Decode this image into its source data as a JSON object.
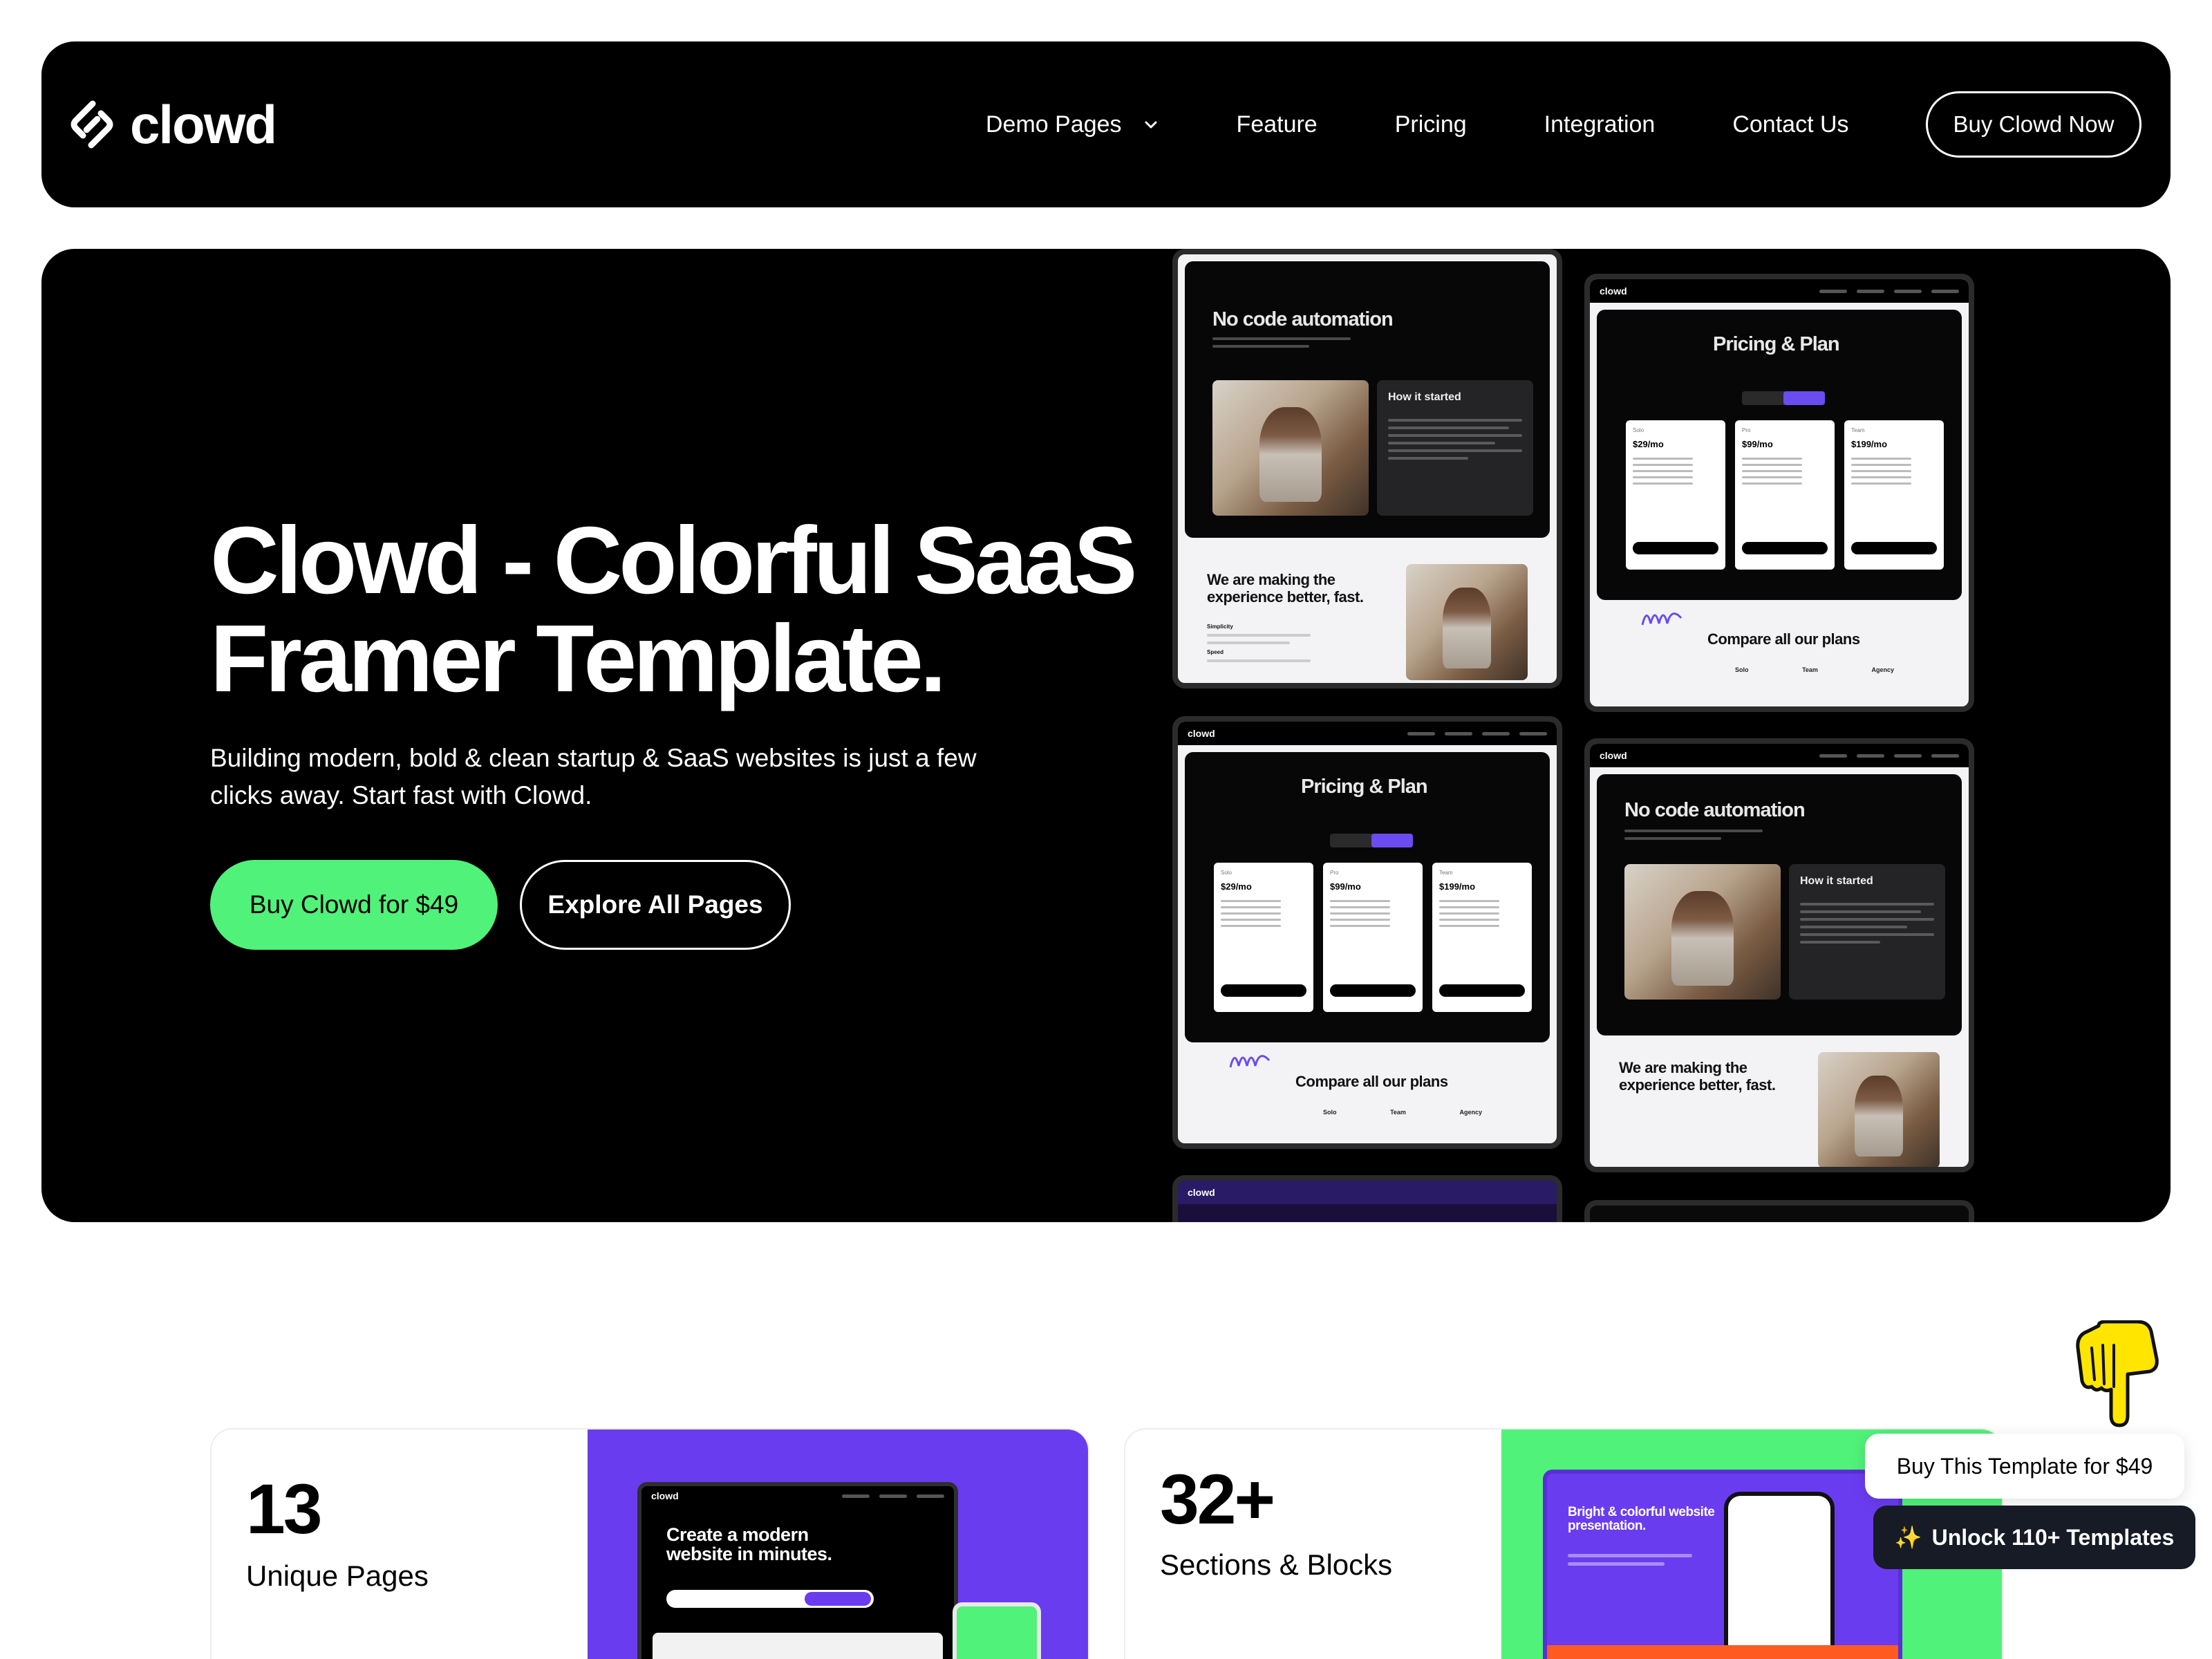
{
  "nav": {
    "logo_text": "clowd",
    "links": [
      {
        "label": "Demo Pages",
        "has_dropdown": true
      },
      {
        "label": "Feature"
      },
      {
        "label": "Pricing"
      },
      {
        "label": "Integration"
      },
      {
        "label": "Contact Us"
      }
    ],
    "cta_label": "Buy Clowd Now"
  },
  "hero": {
    "title": "Clowd - Colorful SaaS Framer Template.",
    "subtitle": "Building modern, bold & clean startup & SaaS websites is just a few clicks away. Start fast with Clowd.",
    "primary_button": "Buy Clowd for $49",
    "secondary_button": "Explore All Pages",
    "previews": {
      "logo": "clowd",
      "automation_title": "No code automation",
      "story_title": "How it started",
      "making_title": "We are making the experience better, fast.",
      "making_items": [
        "Simplicity",
        "Speed"
      ],
      "pricing_title": "Pricing & Plan",
      "compare_title": "Compare all our plans",
      "plans": [
        {
          "name": "Solo",
          "price": "$29/mo"
        },
        {
          "name": "Pro",
          "price": "$99/mo"
        },
        {
          "name": "Team",
          "price": "$199/mo"
        }
      ],
      "table_cols": [
        "Solo",
        "Team",
        "Agency"
      ]
    }
  },
  "stats": [
    {
      "number": "13",
      "label": "Unique Pages",
      "media_color": "#6a3cf0",
      "mock_title": "Create a modern website in minutes."
    },
    {
      "number": "32+",
      "label": "Sections & Blocks",
      "media_color": "#50f27a",
      "mock_title": "Bright & colorful website presentation."
    }
  ],
  "floating": {
    "buy_label": "Buy This Template for $49",
    "unlock_label": "Unlock 110+ Templates",
    "unlock_icon": "sparkle-icon",
    "hand_icon": "pointing-hand-icon"
  },
  "colors": {
    "accent_green": "#50f27a",
    "accent_purple": "#6a3cf0",
    "dark": "#000000",
    "unlock_bg": "#161b26"
  }
}
